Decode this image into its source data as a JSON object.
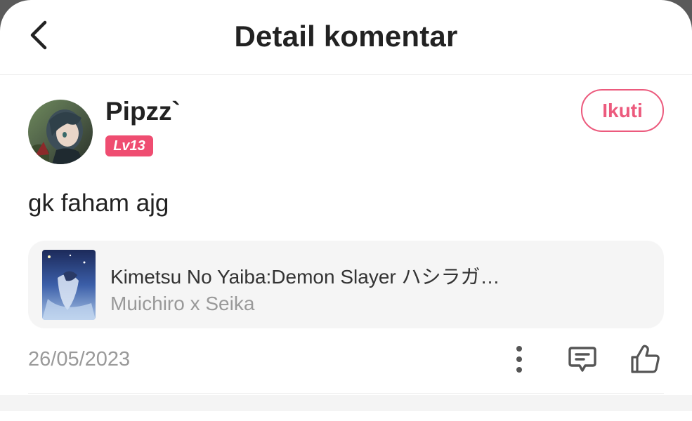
{
  "header": {
    "title": "Detail komentar",
    "back_icon": "chevron-left-icon"
  },
  "comment": {
    "username": "Pipzz`",
    "level": "Lv13",
    "follow_label": "Ikuti",
    "text": "gk faham ajg",
    "date": "26/05/2023",
    "reference": {
      "title": "Kimetsu No Yaiba:Demon Slayer ハシラガ…",
      "subtitle": "Muichiro x Seika"
    },
    "actions": [
      "more-vertical-icon",
      "comment-icon",
      "thumbs-up-icon"
    ]
  },
  "colors": {
    "accent": "#ec5a7d",
    "badge": "#ef4d71",
    "text": "#222222",
    "muted": "#9a9a9a"
  }
}
